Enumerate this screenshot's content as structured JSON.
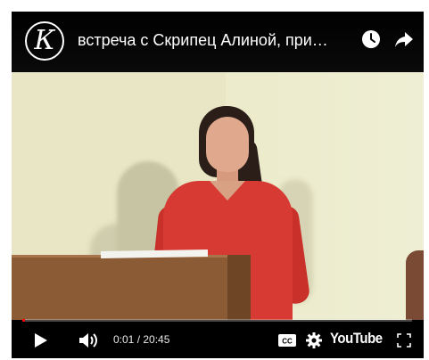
{
  "video": {
    "channel_logo_letter": "К",
    "title": "встреча с Скрипец Алиной, при…"
  },
  "header_icons": {
    "watch_later": "clock-icon",
    "share": "share-icon"
  },
  "player": {
    "current_time": "0:01",
    "duration": "20:45",
    "time_display": "0:01 / 20:45",
    "progress_fraction": 0.0008,
    "brand": "YouTube"
  },
  "controls": {
    "play": "play-icon",
    "volume": "volume-icon",
    "captions": "cc-icon",
    "settings": "gear-icon",
    "fullscreen": "fullscreen-icon"
  },
  "colors": {
    "progress_played": "#ff0000",
    "background": "#000000"
  }
}
